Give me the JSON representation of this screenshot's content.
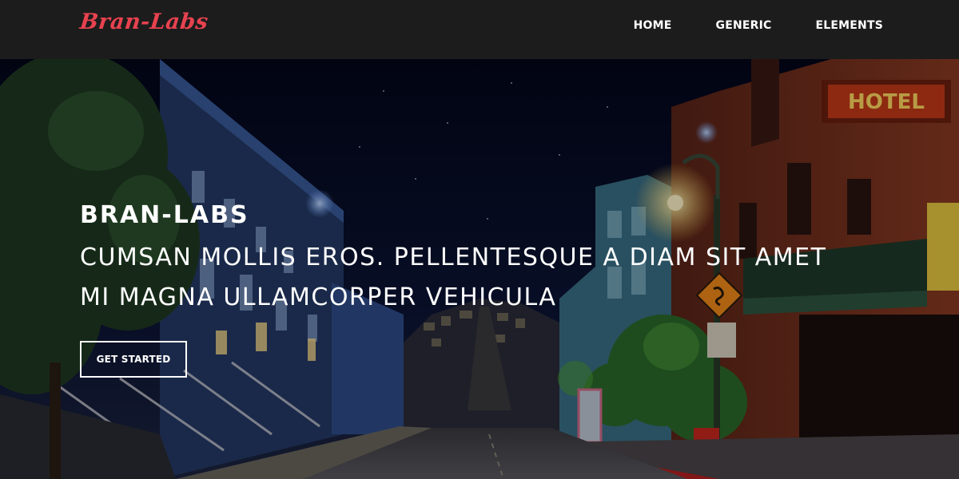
{
  "site": {
    "logo_text": "Bran-Labs"
  },
  "nav": {
    "items": [
      {
        "label": "HOME"
      },
      {
        "label": "GENERIC"
      },
      {
        "label": "ELEMENTS"
      }
    ]
  },
  "hero": {
    "title": "BRAN-LABS",
    "subtitle_line1": "CUMSAN MOLLIS EROS. PELLENTESQUE A DIAM SIT AMET",
    "subtitle_line2": "MI MAGNA ULLAMCORPER VEHICULA",
    "cta_label": "GET STARTED",
    "sign_text": "HOTEL"
  },
  "colors": {
    "navbar_bg": "#1c1c1c",
    "logo": "#e8424f",
    "text": "#ffffff"
  }
}
